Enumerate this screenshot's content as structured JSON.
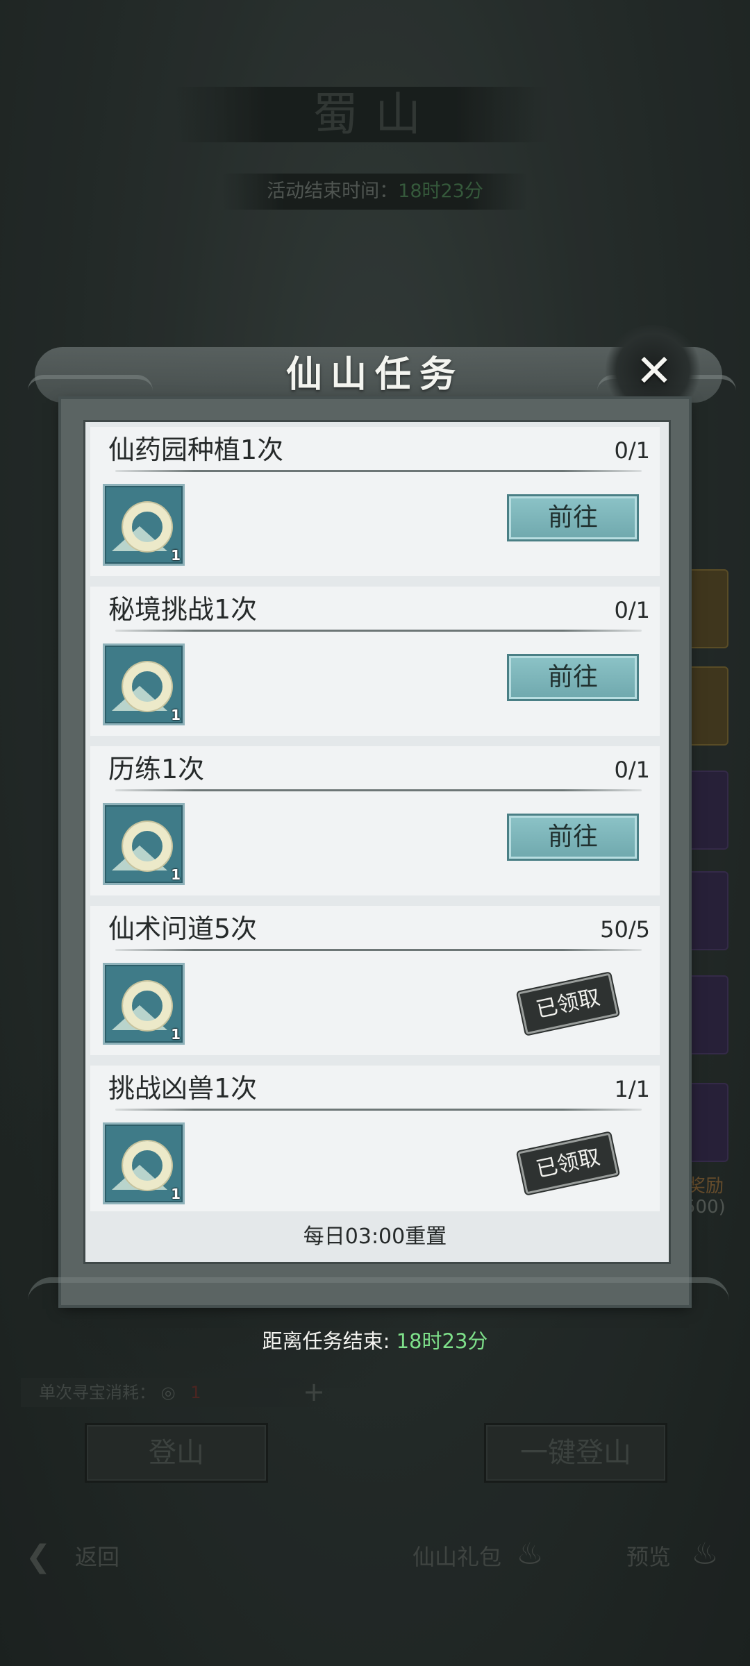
{
  "background": {
    "title": "蜀山",
    "event_time_label": "活动结束时间：",
    "event_time_value": "18时23分",
    "cost_label": "单次寻宝消耗：",
    "cost_value": "1",
    "climb_button": "登山",
    "one_key_climb_button": "一键登山",
    "side_reward_label": "奖励",
    "side_reward_count": "500)",
    "nav": {
      "back": "返回",
      "gift_pack": "仙山礼包",
      "preview": "预览"
    }
  },
  "modal": {
    "title": "仙山任务",
    "tasks": [
      {
        "title": "仙药园种植1次",
        "progress": "0/1",
        "reward_count": "1",
        "state": "go",
        "button": "前往"
      },
      {
        "title": "秘境挑战1次",
        "progress": "0/1",
        "reward_count": "1",
        "state": "go",
        "button": "前往"
      },
      {
        "title": "历练1次",
        "progress": "0/1",
        "reward_count": "1",
        "state": "go",
        "button": "前往"
      },
      {
        "title": "仙术问道5次",
        "progress": "50/5",
        "reward_count": "1",
        "state": "claimed",
        "button": "已领取"
      },
      {
        "title": "挑战凶兽1次",
        "progress": "1/1",
        "reward_count": "1",
        "state": "claimed",
        "button": "已领取"
      }
    ],
    "reset_note": "每日03:00重置",
    "task_end_label": "距离任务结束:",
    "task_end_value": "18时23分"
  },
  "colors": {
    "go_button": "#7ab4b9",
    "highlight_green": "#7ee08a",
    "reward_icon_bg": "#3f7b88"
  },
  "icons": [
    "close-icon",
    "jade-ring-icon",
    "back-arrow-icon",
    "gift-pack-icon",
    "preview-icon",
    "plus-icon"
  ]
}
